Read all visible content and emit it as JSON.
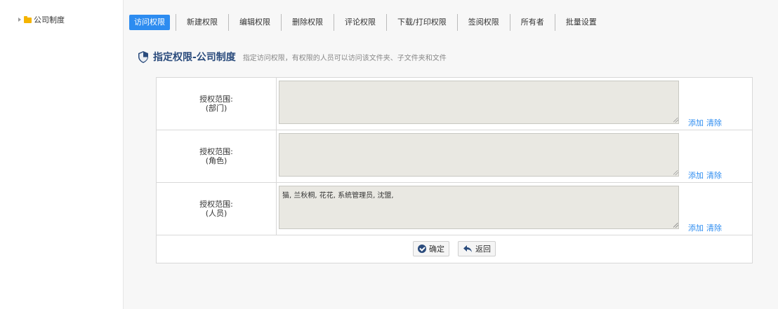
{
  "tree": {
    "root_label": "公司制度"
  },
  "tabs": [
    {
      "label": "访问权限",
      "active": true
    },
    {
      "label": "新建权限"
    },
    {
      "label": "编辑权限"
    },
    {
      "label": "删除权限"
    },
    {
      "label": "评论权限"
    },
    {
      "label": "下载/打印权限"
    },
    {
      "label": "签阅权限"
    },
    {
      "label": "所有者"
    },
    {
      "label": "批量设置"
    }
  ],
  "heading": {
    "title": "指定权限-公司制度",
    "description": "指定访问权限，有权限的人员可以访问该文件夹、子文件夹和文件"
  },
  "rows": [
    {
      "label_line1": "授权范围:",
      "label_line2": "(部门)",
      "value": "",
      "add": "添加",
      "clear": "清除"
    },
    {
      "label_line1": "授权范围:",
      "label_line2": "(角色)",
      "value": "",
      "add": "添加",
      "clear": "清除"
    },
    {
      "label_line1": "授权范围:",
      "label_line2": "(人员)",
      "value": "猫, 兰秋桐, 花花, 系統管理员, 沈盟,",
      "add": "添加",
      "clear": "清除"
    }
  ],
  "buttons": {
    "confirm": "确定",
    "back": "返回"
  },
  "colors": {
    "accent": "#2d8cf0",
    "heading": "#2a4b7c",
    "textarea_bg": "#e9e8e2"
  }
}
